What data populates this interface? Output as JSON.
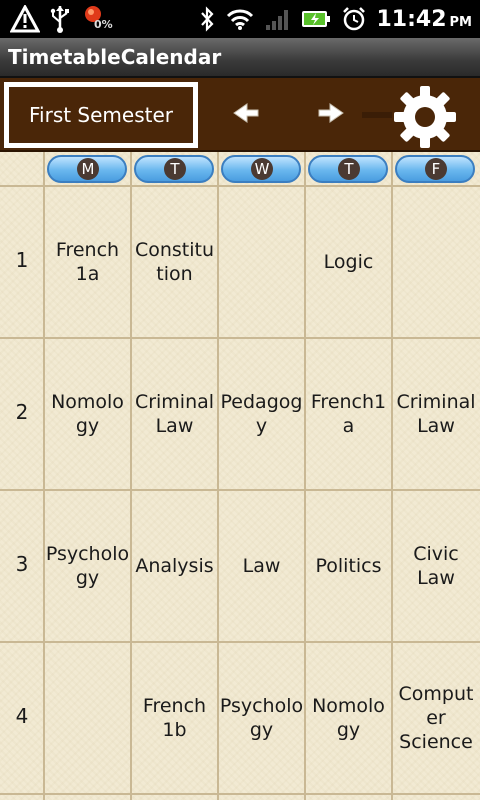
{
  "status_bar": {
    "icons": [
      "warning-icon",
      "usb-icon",
      "battery-alert-icon",
      "bluetooth-icon",
      "wifi-icon",
      "signal-icon",
      "battery-charging-icon",
      "alarm-icon"
    ],
    "battery_percent": "0%",
    "time": "11:42",
    "ampm": "PM"
  },
  "app": {
    "title": "TimetableCalendar"
  },
  "toolbar": {
    "semester_label": "First Semester",
    "prev_icon": "arrow-left-icon",
    "next_icon": "arrow-right-icon",
    "settings_icon": "gear-icon"
  },
  "days": [
    "M",
    "T",
    "W",
    "T",
    "F"
  ],
  "rows": [
    {
      "period": "1",
      "cells": [
        "French\n1a",
        "Constitu\ntion",
        "",
        "Logic",
        ""
      ]
    },
    {
      "period": "2",
      "cells": [
        "Nomolo\ngy",
        "Criminal\nLaw",
        "Pedagog\ny",
        "French1\na",
        "Criminal\nLaw"
      ]
    },
    {
      "period": "3",
      "cells": [
        "Psycholo\ngy",
        "Analysis",
        "Law",
        "Politics",
        "Civic\nLaw"
      ]
    },
    {
      "period": "4",
      "cells": [
        "",
        "French\n1b",
        "Psycholo\ngy",
        "Nomolo\ngy",
        "Comput\ner\nScience"
      ]
    }
  ],
  "colors": {
    "toolbar_bg": "#4a2608",
    "grid_bg": "#f2ead3",
    "day_pill": "#6ab7ee"
  }
}
